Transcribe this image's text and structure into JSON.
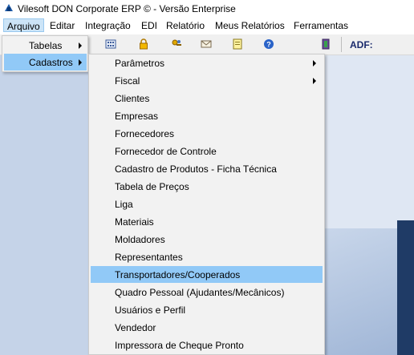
{
  "window": {
    "title": "Vilesoft DON Corporate ERP © - Versão Enterprise"
  },
  "menubar": [
    "Arquivo",
    "Editar",
    "Integração",
    "EDI",
    "Relatório",
    "Meus Relatórios",
    "Ferramentas"
  ],
  "toolbar": {
    "adf_label": "ADF:",
    "icons": [
      "calculator-icon",
      "lock-icon",
      "key-people-icon",
      "mail-icon",
      "notes-icon",
      "help-icon",
      "exit-door-icon"
    ]
  },
  "submenu1": [
    {
      "label": "Tabelas",
      "has_submenu": true,
      "selected": false
    },
    {
      "label": "Cadastros",
      "has_submenu": true,
      "selected": true
    }
  ],
  "submenu2": [
    {
      "label": "Parâmetros",
      "has_submenu": true,
      "selected": false
    },
    {
      "label": "Fiscal",
      "has_submenu": true,
      "selected": false
    },
    {
      "label": "Clientes",
      "has_submenu": false,
      "selected": false
    },
    {
      "label": "Empresas",
      "has_submenu": false,
      "selected": false
    },
    {
      "label": "Fornecedores",
      "has_submenu": false,
      "selected": false
    },
    {
      "label": "Fornecedor de Controle",
      "has_submenu": false,
      "selected": false
    },
    {
      "label": "Cadastro de Produtos - Ficha Técnica",
      "has_submenu": false,
      "selected": false
    },
    {
      "label": "Tabela de Preços",
      "has_submenu": false,
      "selected": false
    },
    {
      "label": "Liga",
      "has_submenu": false,
      "selected": false
    },
    {
      "label": "Materiais",
      "has_submenu": false,
      "selected": false
    },
    {
      "label": "Moldadores",
      "has_submenu": false,
      "selected": false
    },
    {
      "label": "Representantes",
      "has_submenu": false,
      "selected": false
    },
    {
      "label": "Transportadores/Cooperados",
      "has_submenu": false,
      "selected": true
    },
    {
      "label": "Quadro Pessoal (Ajudantes/Mecânicos)",
      "has_submenu": false,
      "selected": false
    },
    {
      "label": "Usuários e Perfil",
      "has_submenu": false,
      "selected": false
    },
    {
      "label": "Vendedor",
      "has_submenu": false,
      "selected": false
    },
    {
      "label": "Impressora de Cheque Pronto",
      "has_submenu": false,
      "selected": false
    }
  ],
  "colors": {
    "selection": "#91c9f7",
    "menu_bg": "#f2f2f2",
    "workspace": "#c5d3e8"
  }
}
